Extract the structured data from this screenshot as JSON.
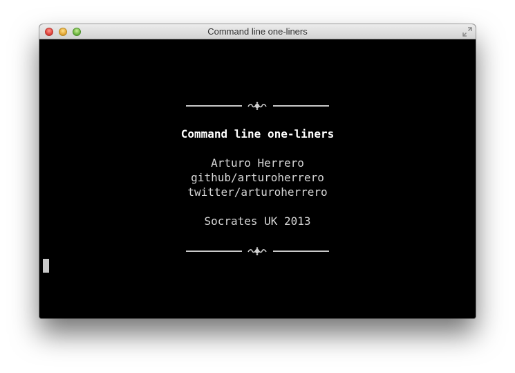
{
  "window": {
    "title": "Command line one-liners"
  },
  "slide": {
    "title": "Command line one-liners",
    "author": "Arturo Herrero",
    "github": "github/arturoherrero",
    "twitter": "twitter/arturoherrero",
    "event": "Socrates UK 2013"
  },
  "icons": {
    "ornament": "floral-fleuron-icon",
    "fullscreen": "fullscreen-arrows-icon"
  },
  "colors": {
    "terminal_background": "#000000",
    "text": "#d6d6d6",
    "title_text": "#ffffff"
  }
}
